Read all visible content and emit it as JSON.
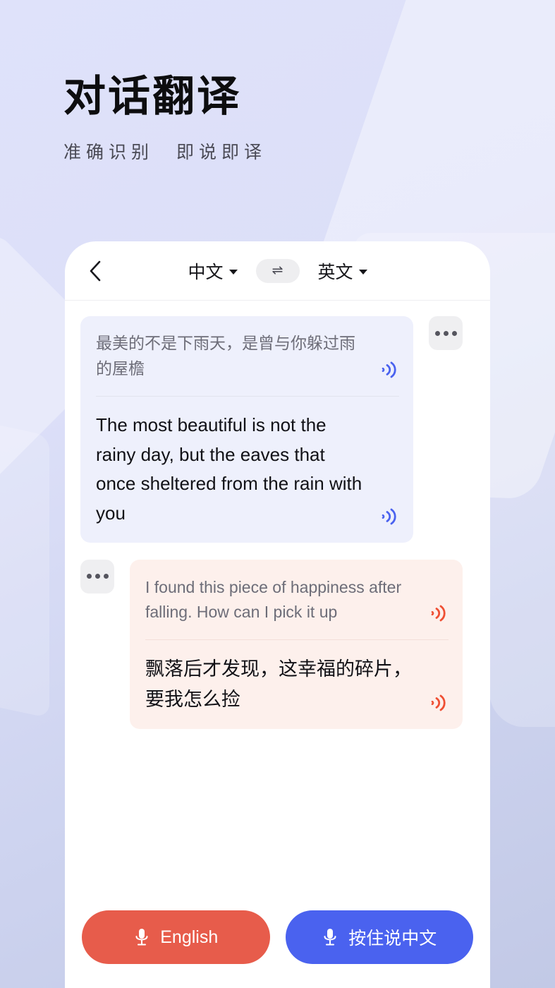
{
  "hero": {
    "title": "对话翻译",
    "subtitle": "准确识别　即说即译"
  },
  "colors": {
    "page_bg": "#dcdff8",
    "accent_blue": "#4a62ef",
    "accent_red": "#e75c4b",
    "bubble_blue": "#eef0fc",
    "bubble_pink": "#fdf0ec",
    "text_primary": "#111116",
    "text_muted": "#6d6d78"
  },
  "phone": {
    "header": {
      "back_icon": "chevron-left-icon",
      "source_lang": "中文",
      "swap_icon": "⇌",
      "target_lang": "英文"
    },
    "messages": [
      {
        "side": "left",
        "theme": "blue",
        "source_text": "最美的不是下雨天，是曾与你躲过雨的屋檐",
        "source_speaker_icon": "sound-wave-icon",
        "translated_text": "The most beautiful is not the rainy day, but the eaves that once sheltered from the rain with you",
        "translated_speaker_icon": "sound-wave-icon",
        "menu_icon": "more-dots-icon"
      },
      {
        "side": "right",
        "theme": "pink",
        "source_text": "I found this piece of happiness after falling. How can I pick it up",
        "source_speaker_icon": "sound-wave-icon",
        "translated_text": "飘落后才发现，这幸福的碎片，要我怎么捡",
        "translated_speaker_icon": "sound-wave-icon",
        "menu_icon": "more-dots-icon"
      }
    ],
    "footer": {
      "mic_icon": "microphone-icon",
      "english_button_label": "English",
      "chinese_button_label": "按住说中文"
    }
  }
}
